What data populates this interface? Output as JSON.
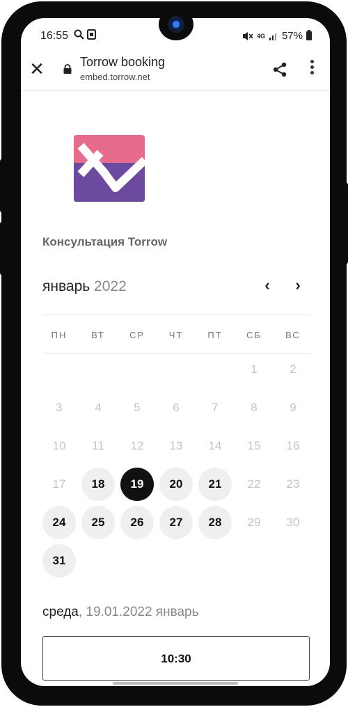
{
  "status_bar": {
    "time": "16:55",
    "left_icons": [
      "search-icon",
      "image-icon"
    ],
    "network": "4G",
    "battery": "57%"
  },
  "browser": {
    "title": "Torrow booking",
    "url": "embed.torrow.net"
  },
  "logo_colors": {
    "top": "#e66b8c",
    "bottom": "#6b4aa0"
  },
  "service_name": "Консультация Torrow",
  "calendar": {
    "month": "январь",
    "year": "2022",
    "weekdays": [
      "ПН",
      "ВТ",
      "СР",
      "ЧТ",
      "ПТ",
      "СБ",
      "ВС"
    ],
    "days": [
      {
        "label": "1",
        "state": "inactive"
      },
      {
        "label": "2",
        "state": "inactive"
      },
      {
        "label": "3",
        "state": "inactive"
      },
      {
        "label": "4",
        "state": "inactive"
      },
      {
        "label": "5",
        "state": "inactive"
      },
      {
        "label": "6",
        "state": "inactive"
      },
      {
        "label": "7",
        "state": "inactive"
      },
      {
        "label": "8",
        "state": "inactive"
      },
      {
        "label": "9",
        "state": "inactive"
      },
      {
        "label": "10",
        "state": "inactive"
      },
      {
        "label": "11",
        "state": "inactive"
      },
      {
        "label": "12",
        "state": "inactive"
      },
      {
        "label": "13",
        "state": "inactive"
      },
      {
        "label": "14",
        "state": "inactive"
      },
      {
        "label": "15",
        "state": "inactive"
      },
      {
        "label": "16",
        "state": "inactive"
      },
      {
        "label": "17",
        "state": "inactive"
      },
      {
        "label": "18",
        "state": "available"
      },
      {
        "label": "19",
        "state": "selected"
      },
      {
        "label": "20",
        "state": "available"
      },
      {
        "label": "21",
        "state": "available"
      },
      {
        "label": "22",
        "state": "inactive"
      },
      {
        "label": "23",
        "state": "inactive"
      },
      {
        "label": "24",
        "state": "available"
      },
      {
        "label": "25",
        "state": "available"
      },
      {
        "label": "26",
        "state": "available"
      },
      {
        "label": "27",
        "state": "available"
      },
      {
        "label": "28",
        "state": "available"
      },
      {
        "label": "29",
        "state": "inactive"
      },
      {
        "label": "30",
        "state": "inactive"
      },
      {
        "label": "31",
        "state": "available"
      }
    ]
  },
  "selected_date": {
    "weekday": "среда",
    "rest": ", 19.01.2022 январь"
  },
  "time_slots": [
    "10:30"
  ]
}
